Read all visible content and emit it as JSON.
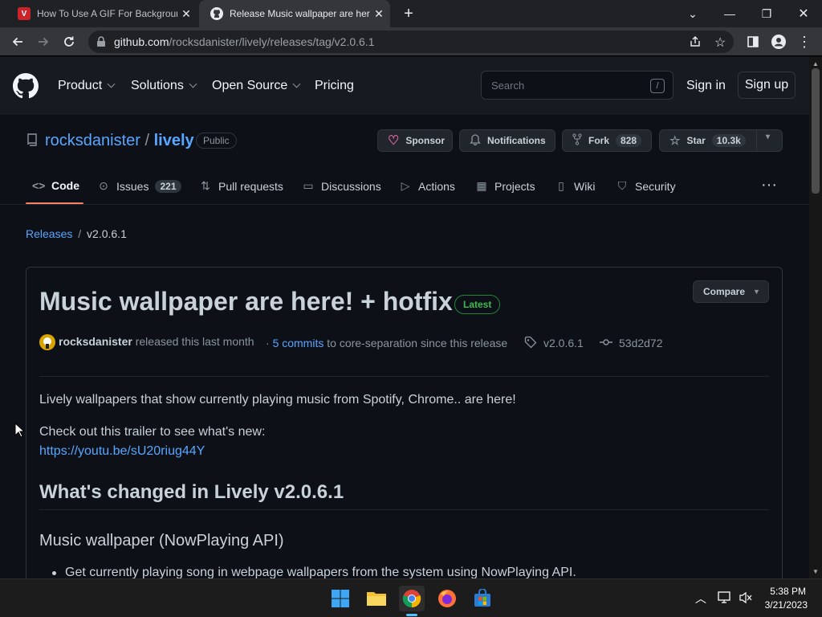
{
  "browser": {
    "tabs": [
      {
        "title": "How To Use A GIF For Background",
        "favicon_letter": "V",
        "favicon_color": "#cc2229"
      },
      {
        "title": "Release Music wallpaper are here",
        "active": true
      }
    ],
    "new_tab_label": "+",
    "url_domain": "github.com",
    "url_path": "/rocksdanister/lively/releases/tag/v2.0.6.1"
  },
  "gh_header": {
    "nav": [
      "Product",
      "Solutions",
      "Open Source",
      "Pricing"
    ],
    "search_placeholder": "Search",
    "search_key": "/",
    "sign_in": "Sign in",
    "sign_up": "Sign up"
  },
  "repo": {
    "owner": "rocksdanister",
    "separator": "/",
    "name": "lively",
    "visibility": "Public",
    "sponsor": "Sponsor",
    "notifications": "Notifications",
    "fork": "Fork",
    "fork_count": "828",
    "star": "Star",
    "star_count": "10.3k",
    "tabs": [
      {
        "label": "Code",
        "icon": "code-icon",
        "active": true
      },
      {
        "label": "Issues",
        "icon": "issue-icon",
        "count": "221"
      },
      {
        "label": "Pull requests",
        "icon": "pull-request-icon"
      },
      {
        "label": "Discussions",
        "icon": "discussions-icon"
      },
      {
        "label": "Actions",
        "icon": "actions-icon"
      },
      {
        "label": "Projects",
        "icon": "projects-icon"
      },
      {
        "label": "Wiki",
        "icon": "wiki-icon"
      },
      {
        "label": "Security",
        "icon": "shield-icon"
      }
    ]
  },
  "breadcrumb": {
    "releases": "Releases",
    "sep": "/",
    "current": "v2.0.6.1"
  },
  "release": {
    "title": "Music wallpaper are here! + hotfix",
    "badge": "Latest",
    "compare": "Compare",
    "author": "rocksdanister",
    "released_text": "released this last month",
    "dot": "·",
    "commits_link": "5 commits",
    "commits_text": "to core-separation since this release",
    "tag": "v2.0.6.1",
    "commit_hash": "53d2d72",
    "body": {
      "p1": "Lively wallpapers that show currently playing music from Spotify, Chrome.. are here!",
      "p2": "Check out this trailer to see what's new:",
      "link": "https://youtu.be/sU20riug44Y",
      "h2": "What's changed in Lively v2.0.6.1",
      "h3": "Music wallpaper (NowPlaying API)",
      "li1": "Get currently playing song in webpage wallpapers from the system using NowPlaying API."
    }
  },
  "taskbar": {
    "time": "5:38 PM",
    "date": "3/21/2023"
  },
  "colors": {
    "accent_link": "#58a6ff",
    "latest_green": "#3fb950",
    "sponsor_pink": "#db61a2",
    "bg": "#0d1117"
  }
}
